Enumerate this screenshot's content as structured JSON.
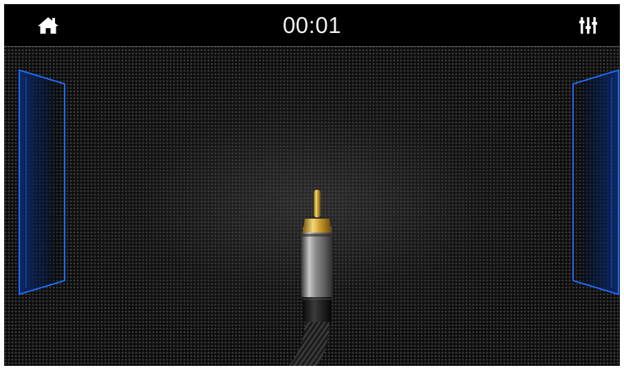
{
  "header": {
    "time": "00:01",
    "home_icon": "home-icon",
    "equalizer_icon": "equalizer-icon"
  },
  "main": {
    "source_graphic": "rca-cable-icon",
    "prev_panel": "left-panel",
    "next_panel": "right-panel"
  },
  "colors": {
    "accent": "#1e6cff",
    "background": "#0f0f0f",
    "topbar": "#000000",
    "text": "#f2f2f2"
  }
}
